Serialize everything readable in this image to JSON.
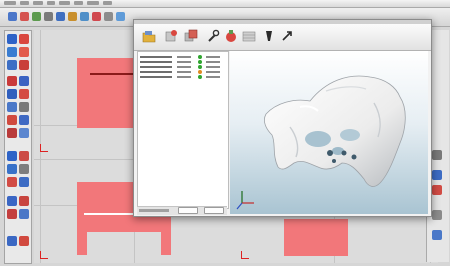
{
  "colors": {
    "accent_red": "#f2777a",
    "viewport_background": "#dcdcdc",
    "dialog_background": "#f2f2f2",
    "status_green": "#2fa52f",
    "status_orange": "#e08a22",
    "part_white": "#f4f4f4"
  },
  "app_menu": {
    "items": [
      "",
      "",
      "",
      "",
      "",
      "",
      "",
      ""
    ]
  },
  "main_toolbar": {
    "icons": [
      "cube-icon",
      "select-icon",
      "rotate-icon",
      "zoom-icon",
      "pan-icon",
      "snap-icon",
      "grid-icon",
      "settings-icon"
    ]
  },
  "left_palette": {
    "icons": [
      "line-tool-icon",
      "arc-tool-icon",
      "rectangle-tool-icon",
      "circle-tool-icon",
      "polygon-tool-icon",
      "text-tool-icon",
      "dimension-tool-icon",
      "extrude-tool-icon",
      "revolve-tool-icon",
      "fillet-tool-icon",
      "boolean-tool-icon",
      "move-tool-icon",
      "mirror-tool-icon",
      "array-tool-icon",
      "layer-tool-icon",
      "color-tool-icon"
    ]
  },
  "print_dialog": {
    "title": "",
    "toolbar_icons": [
      "open-folder-icon",
      "import-part-icon",
      "copy-part-icon",
      "wrench-icon",
      "repair-icon",
      "slice-icon",
      "print-icon",
      "export-icon"
    ],
    "list_rows": [
      {
        "name": "",
        "count": "",
        "status": "ok",
        "size": ""
      },
      {
        "name": "",
        "count": "",
        "status": "ok",
        "size": ""
      },
      {
        "name": "",
        "count": "",
        "status": "ok",
        "size": ""
      },
      {
        "name": "",
        "count": "",
        "status": "warn",
        "size": ""
      },
      {
        "name": "",
        "count": "",
        "status": "ok",
        "size": ""
      }
    ],
    "status_text": "",
    "button_labels": [
      "",
      ""
    ]
  }
}
